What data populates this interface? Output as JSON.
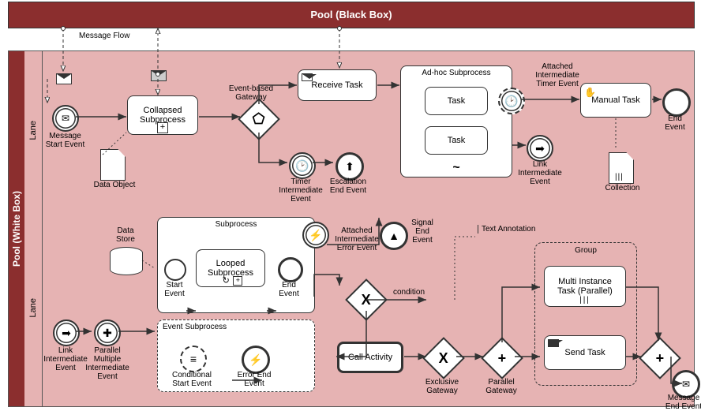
{
  "pool_black": "Pool (Black Box)",
  "pool_white": "Pool (White Box)",
  "lane1": "Lane",
  "lane2": "Lane",
  "msgflow": "Message Flow",
  "l1": {
    "msg_start": "Message\nStart Event",
    "collapsed_sub": "Collapsed\nSubprocess",
    "data_obj": "Data Object",
    "evt_gateway": "Event-based\nGateway",
    "receive_task": "Receive Task",
    "timer_int": "Timer\nIntermediate\nEvent",
    "esc_end": "Escalation\nEnd Event",
    "adhoc": "Ad-hoc Subprocess",
    "task1": "Task",
    "task2": "Task",
    "attached_timer": "Attached\nIntermediate\nTimer Event",
    "link_int": "Link\nIntermediate\nEvent",
    "manual": "Manual Task",
    "end": "End\nEvent",
    "collection": "Collection"
  },
  "l2": {
    "link_int": "Link\nIntermediate\nEvent",
    "parallel_multi": "Parallel\nMultiple\nIntermediate\nEvent",
    "data_store": "Data\nStore",
    "subproc": "Subprocess",
    "start_evt": "Start\nEvent",
    "looped_sub": "Looped\nSubprocess",
    "end_evt": "End\nEvent",
    "evt_subproc": "Event Subprocess",
    "cond_start": "Conditional\nStart Event",
    "err_end": "Error End\nEvent",
    "attached_err": "Attached\nIntermediate\nError Event",
    "signal_end": "Signal\nEnd\nEvent",
    "condition": "condition",
    "call_act": "Call Activity",
    "excl_gw": "Exclusive\nGateway",
    "par_gw": "Parallel\nGateway",
    "txt_ann": "Text Annotation",
    "group": "Group",
    "multi_inst": "Multi Instance\nTask (Parallel)",
    "send_task": "Send Task",
    "msg_end": "Message\nEnd Event"
  }
}
